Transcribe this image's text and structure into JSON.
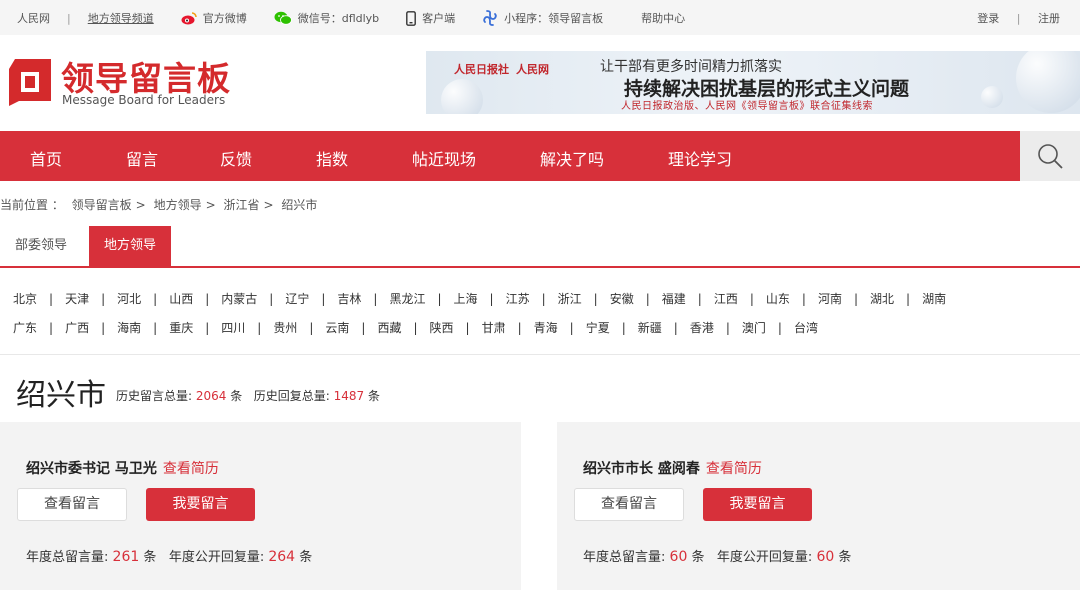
{
  "topbar": {
    "site": "人民网",
    "channel": "地方领导频道",
    "weibo": "官方微博",
    "wechat": "微信号：dfldlyb",
    "client": "客户端",
    "miniprogram": "小程序：领导留言板",
    "help": "帮助中心",
    "login": "登录",
    "register": "注册"
  },
  "header": {
    "logo_cn": "领导留言板",
    "logo_en": "Message Board for Leaders",
    "banner": {
      "brand1": "人民日报社",
      "brand2": "人民网",
      "line1": "让干部有更多时间精力抓落实",
      "line2": "持续解决困扰基层的形式主义问题",
      "line3": "人民日报政治版、人民网《领导留言板》联合征集线索"
    }
  },
  "nav": {
    "items": [
      "首页",
      "留言",
      "反馈",
      "指数",
      "帖近现场",
      "解决了吗",
      "理论学习"
    ]
  },
  "breadcrumb": {
    "prefix": "当前位置 ：",
    "path": [
      "领导留言板",
      "地方领导",
      "浙江省",
      "绍兴市"
    ],
    "sep": ">"
  },
  "tabs": [
    {
      "label": "部委领导",
      "active": false
    },
    {
      "label": "地方领导",
      "active": true
    }
  ],
  "provinces": {
    "row1": [
      "北京",
      "天津",
      "河北",
      "山西",
      "内蒙古",
      "辽宁",
      "吉林",
      "黑龙江",
      "上海",
      "江苏",
      "浙江",
      "安徽",
      "福建",
      "江西",
      "山东",
      "河南",
      "湖北",
      "湖南"
    ],
    "row2": [
      "广东",
      "广西",
      "海南",
      "重庆",
      "四川",
      "贵州",
      "云南",
      "西藏",
      "陕西",
      "甘肃",
      "青海",
      "宁夏",
      "新疆",
      "香港",
      "澳门",
      "台湾"
    ],
    "sep": "|"
  },
  "city": {
    "name": "绍兴市",
    "hist_msg_label": "历史留言总量:",
    "hist_msg": "2064",
    "hist_reply_label": "历史回复总量:",
    "hist_reply": "1487",
    "unit": "条"
  },
  "leaders": [
    {
      "title": "绍兴市委书记 马卫光",
      "resume": "查看简历",
      "view": "查看留言",
      "post": "我要留言",
      "year_msg_label": "年度总留言量:",
      "year_msg": "261",
      "year_reply_label": "年度公开回复量:",
      "year_reply": "264",
      "unit": "条"
    },
    {
      "title": "绍兴市市长 盛阅春",
      "resume": "查看简历",
      "view": "查看留言",
      "post": "我要留言",
      "year_msg_label": "年度总留言量:",
      "year_msg": "60",
      "year_reply_label": "年度公开回复量:",
      "year_reply": "60",
      "unit": "条"
    }
  ],
  "colors": {
    "brand_red": "#d7303a",
    "topbar_bg": "#f5f5f5",
    "card_bg": "#f3f3f3"
  }
}
